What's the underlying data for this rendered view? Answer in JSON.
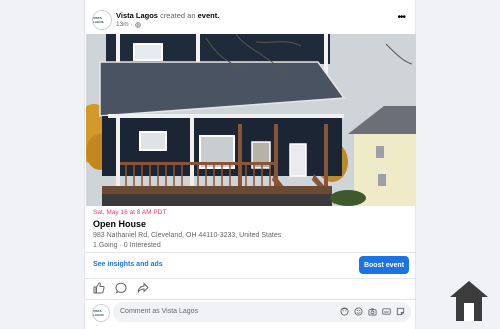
{
  "post": {
    "author": "Vista Lagos",
    "action_text": "created an",
    "action_object": "event.",
    "time": "13m",
    "avatar_text": "VISTA LAGOS"
  },
  "event": {
    "date": "Sat, May 16 at 8 AM PDT",
    "title": "Open House",
    "address": "983 Nathaniel Rd, Cleveland, OH 44110-3233, United States",
    "stats": "1 Going · 0 Interested"
  },
  "footer": {
    "insights_label": "See insights and ads",
    "boost_label": "Boost event"
  },
  "comment": {
    "placeholder": "Comment as Vista Lagos"
  },
  "colors": {
    "accent": "#1b74e4",
    "date": "#e4405f",
    "house_siding": "#1f2a3a",
    "porch": "#8a5436"
  },
  "icons": [
    "globe-icon",
    "more-icon",
    "like-icon",
    "comment-icon",
    "share-icon",
    "emoji-icon",
    "avatar-sticker-icon",
    "camera-icon",
    "gif-icon",
    "sticker-icon",
    "home-logo-icon"
  ]
}
